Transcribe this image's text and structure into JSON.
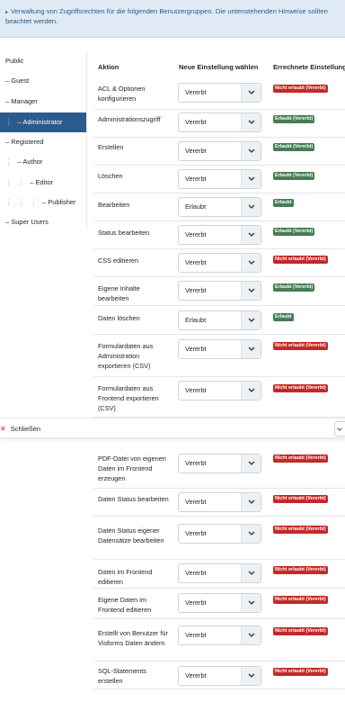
{
  "info": {
    "text": "Verwaltung von Zugriffsrechten für die folgenden Benutzergruppen. Die untenstehenden Hinweise sollten beachtet werden."
  },
  "groups": [
    {
      "label": "Public",
      "indent": ""
    },
    {
      "label": "– Guest",
      "indent": ""
    },
    {
      "label": "– Manager",
      "indent": ""
    },
    {
      "label": "– Administrator",
      "indent": "⋮",
      "active": true
    },
    {
      "label": "– Registered",
      "indent": ""
    },
    {
      "label": "– Author",
      "indent": "⋮"
    },
    {
      "label": "– Editor",
      "indent": "⋮   ⋮"
    },
    {
      "label": "– Publisher",
      "indent": "⋮   ⋮   ⋮"
    },
    {
      "label": "– Super Users",
      "indent": ""
    }
  ],
  "headers": {
    "action": "Aktion",
    "new_setting": "Neue Einstellung wählen",
    "calculated": "Errechnete Einstellung"
  },
  "colors": {
    "denied": "#c52827",
    "allowed": "#457d54",
    "accent": "#2b5b8c"
  },
  "rows": [
    {
      "action": "ACL & Optionen konfigurieren",
      "setting": "Vererbt",
      "result": "Nicht erlaubt (Vererbt)",
      "status": "denied"
    },
    {
      "action": "Administrationszugriff",
      "setting": "Vererbt",
      "result": "Erlaubt (Vererbt)",
      "status": "allowed"
    },
    {
      "action": "Erstellen",
      "setting": "Vererbt",
      "result": "Erlaubt (Vererbt)",
      "status": "allowed"
    },
    {
      "action": "Löschen",
      "setting": "Vererbt",
      "result": "Erlaubt (Vererbt)",
      "status": "allowed"
    },
    {
      "action": "Bearbeiten",
      "setting": "Erlaubt",
      "result": "Erlaubt",
      "status": "allowed"
    },
    {
      "action": "Status bearbeiten",
      "setting": "Vererbt",
      "result": "Erlaubt (Vererbt)",
      "status": "allowed"
    },
    {
      "action": "CSS editieren",
      "setting": "Vererbt",
      "result": "Nicht erlaubt (Vererbt)",
      "status": "denied"
    },
    {
      "action": "Eigene Inhalte bearbeiten",
      "setting": "Vererbt",
      "result": "Erlaubt (Vererbt)",
      "status": "allowed"
    },
    {
      "action": "Daten löschen",
      "setting": "Erlaubt",
      "result": "Erlaubt",
      "status": "allowed"
    },
    {
      "action": "Formulardaten aus Administration exportieren (CSV)",
      "setting": "Vererbt",
      "result": "Nicht erlaubt (Vererbt)",
      "status": "denied"
    },
    {
      "action": "Formulardaten aus Frontend exportieren (CSV)",
      "setting": "Vererbt",
      "result": "Nicht erlaubt (Vererbt)",
      "status": "denied"
    },
    {
      "action": "PDF-Datei von eigenen Daten im Frontend erzeugen",
      "setting": "Vererbt",
      "result": "Nicht erlaubt (Vererbt)",
      "status": "denied"
    },
    {
      "action": "Daten Status bearbeiten",
      "setting": "Vererbt",
      "result": "Nicht erlaubt (Vererbt)",
      "status": "denied"
    },
    {
      "action": "Daten Status eigener Datensätze bearbeiten",
      "setting": "Vererbt",
      "result": "Nicht erlaubt (Vererbt)",
      "status": "denied"
    },
    {
      "action": "Daten im Frontend editieren",
      "setting": "Vererbt",
      "result": "Nicht erlaubt (Vererbt)",
      "status": "denied"
    },
    {
      "action": "Eigene Daten im Frontend editieren",
      "setting": "Vererbt",
      "result": "Nicht erlaubt (Vererbt)",
      "status": "denied"
    },
    {
      "action": "Erstellt von Benutzer für Visforms Daten ändern",
      "setting": "Vererbt",
      "result": "Nicht erlaubt (Vererbt)",
      "status": "denied"
    },
    {
      "action": "SQL-Statements erstellen",
      "setting": "Vererbt",
      "result": "Nicht erlaubt (Vererbt)",
      "status": "denied"
    }
  ],
  "footer": {
    "close_label": "Schließen"
  }
}
